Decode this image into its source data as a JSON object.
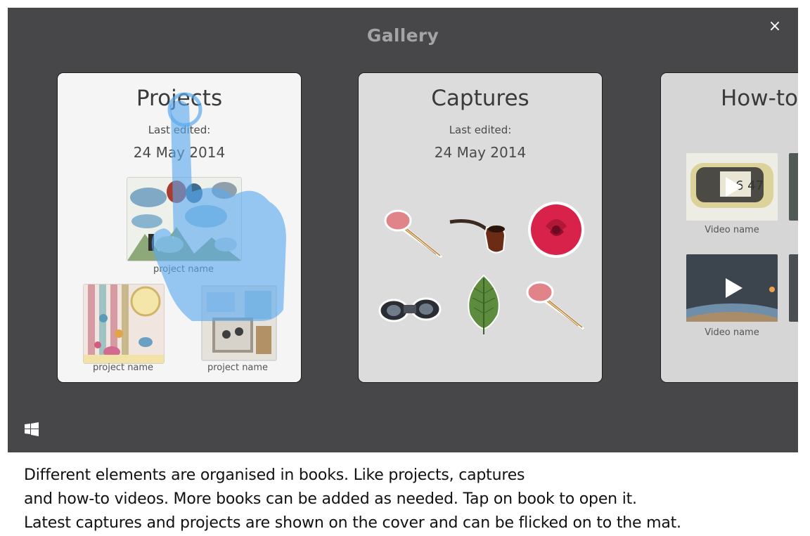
{
  "window": {
    "title": "Gallery",
    "close_label": "×"
  },
  "books": {
    "projects": {
      "title": "Projects",
      "edited_label": "Last edited:",
      "edited_date": "24 May 2014",
      "items": [
        {
          "name": "project name"
        },
        {
          "name": "project name"
        },
        {
          "name": "project name"
        }
      ]
    },
    "captures": {
      "title": "Captures",
      "edited_label": "Last edited:",
      "edited_date": "24 May 2014"
    },
    "howto": {
      "title": "How-to-",
      "videos": [
        {
          "name": "Video name"
        },
        {
          "name": "Video name"
        }
      ]
    }
  },
  "caption": {
    "line1": "Different elements are organised in books. Like projects, captures",
    "line2": "and how-to videos. More books can be added as needed. Tap on book to open it.",
    "line3": "Latest captures and projects are shown on the cover and can be flicked on to the mat."
  },
  "colors": {
    "app_background": "#474749",
    "title_color": "#a4a4a6",
    "hand_overlay": "#5aaaf0"
  }
}
